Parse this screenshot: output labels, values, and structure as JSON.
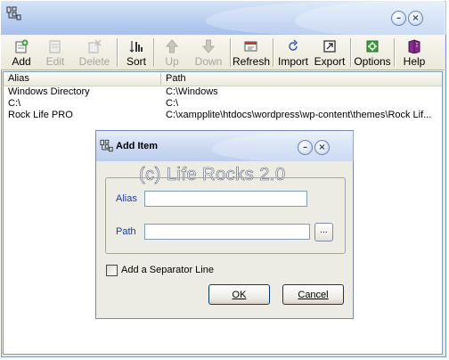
{
  "main_window": {
    "title": "",
    "minimize_glyph": "–",
    "close_glyph": "×"
  },
  "toolbar": {
    "buttons": [
      {
        "label": "Add",
        "icon": "add-icon",
        "enabled": true
      },
      {
        "label": "Edit",
        "icon": "edit-icon",
        "enabled": false
      },
      {
        "label": "Delete",
        "icon": "delete-icon",
        "enabled": false
      },
      {
        "label": "Sort",
        "icon": "sort-icon",
        "enabled": true
      },
      {
        "label": "Up",
        "icon": "arrow-up-icon",
        "enabled": false
      },
      {
        "label": "Down",
        "icon": "arrow-down-icon",
        "enabled": false
      },
      {
        "label": "Refresh",
        "icon": "refresh-icon",
        "enabled": true
      },
      {
        "label": "Import",
        "icon": "import-icon",
        "enabled": true
      },
      {
        "label": "Export",
        "icon": "export-icon",
        "enabled": true
      },
      {
        "label": "Options",
        "icon": "options-icon",
        "enabled": true
      },
      {
        "label": "Help",
        "icon": "help-book-icon",
        "enabled": true
      }
    ]
  },
  "list": {
    "columns": [
      "Alias",
      "Path"
    ],
    "rows": [
      {
        "alias": "Windows Directory",
        "path": "C:\\Windows"
      },
      {
        "alias": "C:\\",
        "path": "C:\\"
      },
      {
        "alias": "Rock Life PRO",
        "path": "C:\\xampplite\\htdocs\\wordpress\\wp-content\\themes\\Rock Lif..."
      }
    ]
  },
  "dialog": {
    "title": "Add Item",
    "watermark": "(c) Life Rocks 2.0",
    "alias_label": "Alias",
    "alias_value": "",
    "path_label": "Path",
    "path_value": "",
    "browse_label": "...",
    "separator_label": "Add a Separator Line",
    "separator_checked": false,
    "ok_label": "OK",
    "cancel_label": "Cancel",
    "minimize_glyph": "–",
    "close_glyph": "×"
  },
  "colors": {
    "titlebar": "#b3c9ee",
    "dialog_label": "#1c3bab",
    "window_bg": "#ece9d8"
  }
}
